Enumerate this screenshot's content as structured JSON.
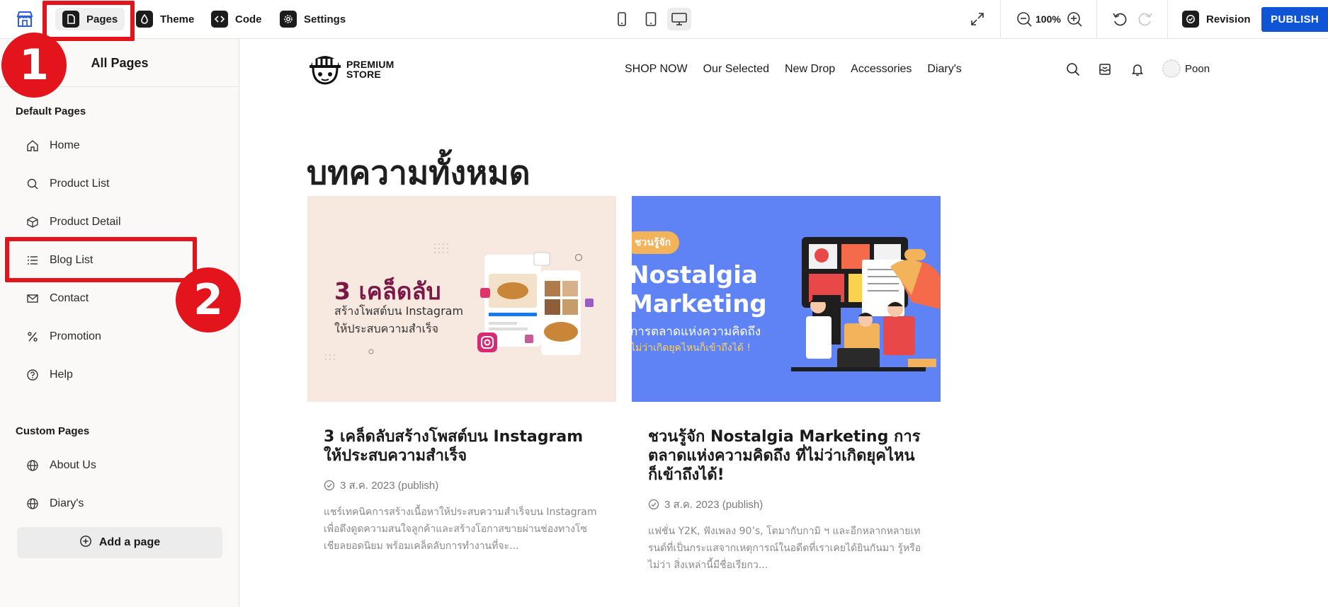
{
  "toolbar": {
    "pages_label": "Pages",
    "theme_label": "Theme",
    "code_label": "Code",
    "settings_label": "Settings",
    "zoom": "100%",
    "revision_label": "Revision",
    "publish_label": "PUBLISH"
  },
  "annotations": {
    "step1": "1",
    "step2": "2",
    "color": "#e3141c"
  },
  "sidebar": {
    "title": "All Pages",
    "default_section": "Default Pages",
    "default_pages": [
      {
        "label": "Home",
        "icon": "home-icon"
      },
      {
        "label": "Product List",
        "icon": "search-icon"
      },
      {
        "label": "Product Detail",
        "icon": "box-icon"
      },
      {
        "label": "Blog List",
        "icon": "list-icon"
      },
      {
        "label": "Contact",
        "icon": "mail-icon"
      },
      {
        "label": "Promotion",
        "icon": "percent-icon"
      },
      {
        "label": "Help",
        "icon": "help-icon"
      }
    ],
    "custom_section": "Custom Pages",
    "custom_pages": [
      {
        "label": "About Us",
        "icon": "globe-icon"
      },
      {
        "label": "Diary's",
        "icon": "globe-icon"
      }
    ],
    "add_page_label": "Add a page"
  },
  "store": {
    "logo_line1": "PREMIUM",
    "logo_line2": "STORE",
    "nav": [
      "SHOP NOW",
      "Our Selected",
      "New Drop",
      "Accessories",
      "Diary's"
    ],
    "user_name": "Poon",
    "page_heading": "บทความทั้งหมด",
    "posts": [
      {
        "thumb_line1": "3 เคล็ดลับ",
        "thumb_line2": "สร้างโพสต์บน Instagram",
        "thumb_line3": "ให้ประสบความสำเร็จ",
        "title": "3 เคล็ดลับสร้างโพสต์บน Instagram ให้ประสบความสำเร็จ",
        "date": "3 ส.ค. 2023 (publish)",
        "excerpt": "แชร์เทคนิคการสร้างเนื้อหาให้ประสบความสำเร็จบน Instagram เพื่อดึงดูดความสนใจลูกค้าและสร้างโอกาสขายผ่านช่องทางโซเชียลยอดนิยม พร้อมเคล็ดลับการทำงานที่จะ..."
      },
      {
        "thumb_tag": "ชวนรู้จัก",
        "thumb_line1": "Nostalgia",
        "thumb_line2": "Marketing",
        "thumb_line3": "การตลาดแห่งความคิดถึง",
        "thumb_line4": "ไม่ว่าเกิดยุคไหนก็เข้าถึงได้ !",
        "title": "ชวนรู้จัก Nostalgia Marketing การตลาดแห่งความคิดถึง ที่ไม่ว่าเกิดยุคไหนก็เข้าถึงได้!",
        "date": "3 ส.ค. 2023 (publish)",
        "excerpt": "แฟชั่น Y2K, ฟังเพลง 90’s, โตมากับกามิ ฯ และอีกหลากหลายเทรนด์ที่เป็นกระแสจากเหตุการณ์ในอดีตที่เราเคยได้ยินกันมา รู้หรือไม่ว่า สิ่งเหล่านี้มีชื่อเรียกว..."
      }
    ]
  },
  "colors": {
    "publish": "#1054d6",
    "sidebar_bg": "#fbf9f8"
  }
}
